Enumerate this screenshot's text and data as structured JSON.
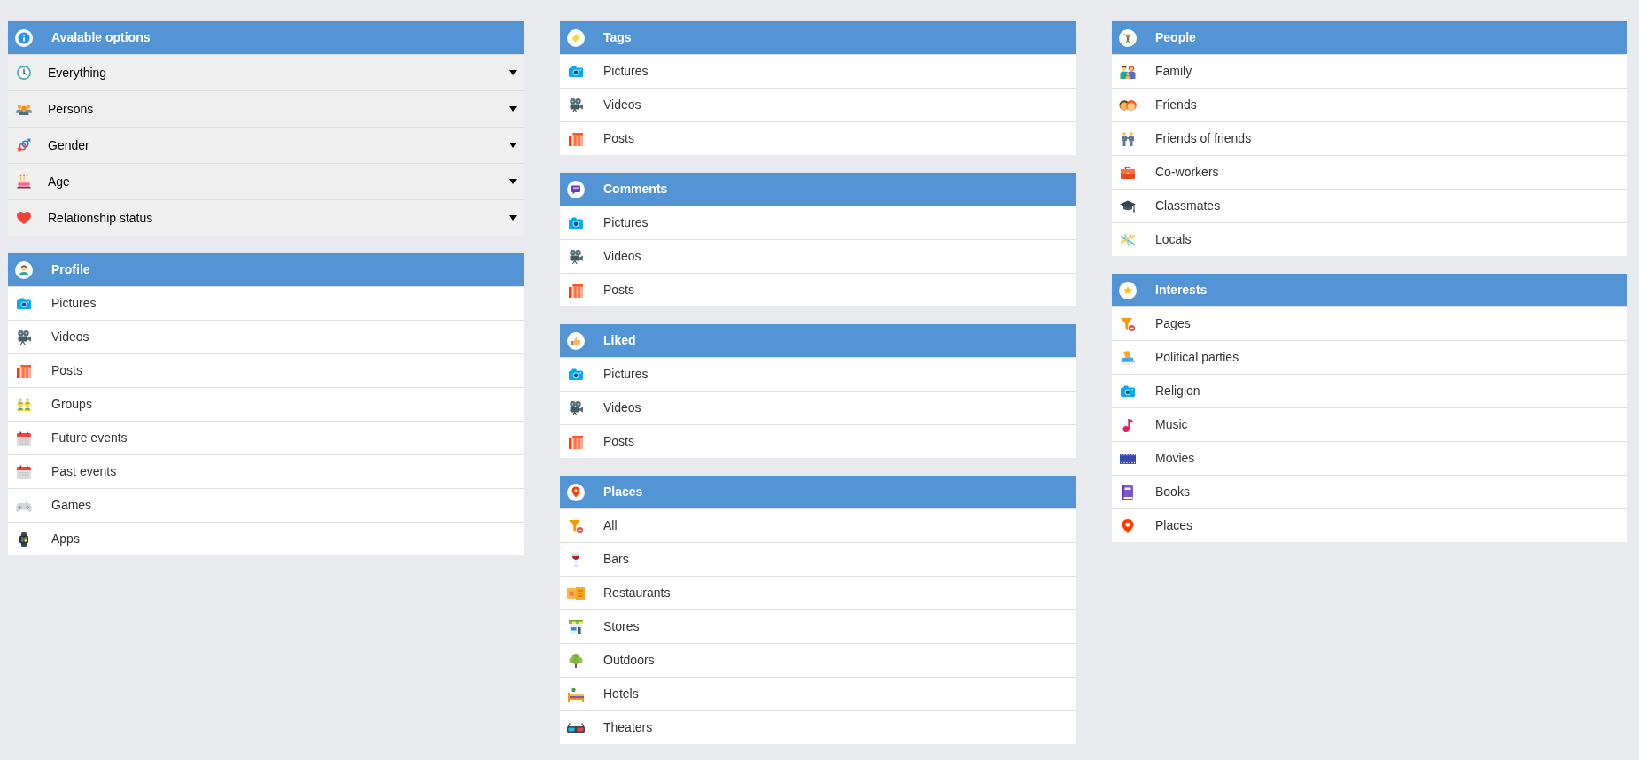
{
  "columns": [
    {
      "panels": [
        {
          "title": "Avalable options",
          "kind": "dropdowns",
          "items": [
            "Everything",
            "Persons",
            "Gender",
            "Age",
            "Relationship status"
          ]
        },
        {
          "title": "Profile",
          "kind": "links",
          "items": [
            "Pictures",
            "Videos",
            "Posts",
            "Groups",
            "Future events",
            "Past events",
            "Games",
            "Apps"
          ]
        }
      ]
    },
    {
      "panels": [
        {
          "title": "Tags",
          "kind": "links",
          "items": [
            "Pictures",
            "Videos",
            "Posts"
          ]
        },
        {
          "title": "Comments",
          "kind": "links",
          "items": [
            "Pictures",
            "Videos",
            "Posts"
          ]
        },
        {
          "title": "Liked",
          "kind": "links",
          "items": [
            "Pictures",
            "Videos",
            "Posts"
          ]
        },
        {
          "title": "Places",
          "kind": "links",
          "items": [
            "All",
            "Bars",
            "Restaurants",
            "Stores",
            "Outdoors",
            "Hotels",
            "Theaters"
          ]
        }
      ]
    },
    {
      "panels": [
        {
          "title": "People",
          "kind": "links",
          "items": [
            "Family",
            "Friends",
            "Friends of friends",
            "Co-workers",
            "Classmates",
            "Locals"
          ]
        },
        {
          "title": "Interests",
          "kind": "links",
          "items": [
            "Pages",
            "Political parties",
            "Religion",
            "Music",
            "Movies",
            "Books",
            "Places"
          ]
        }
      ]
    }
  ]
}
